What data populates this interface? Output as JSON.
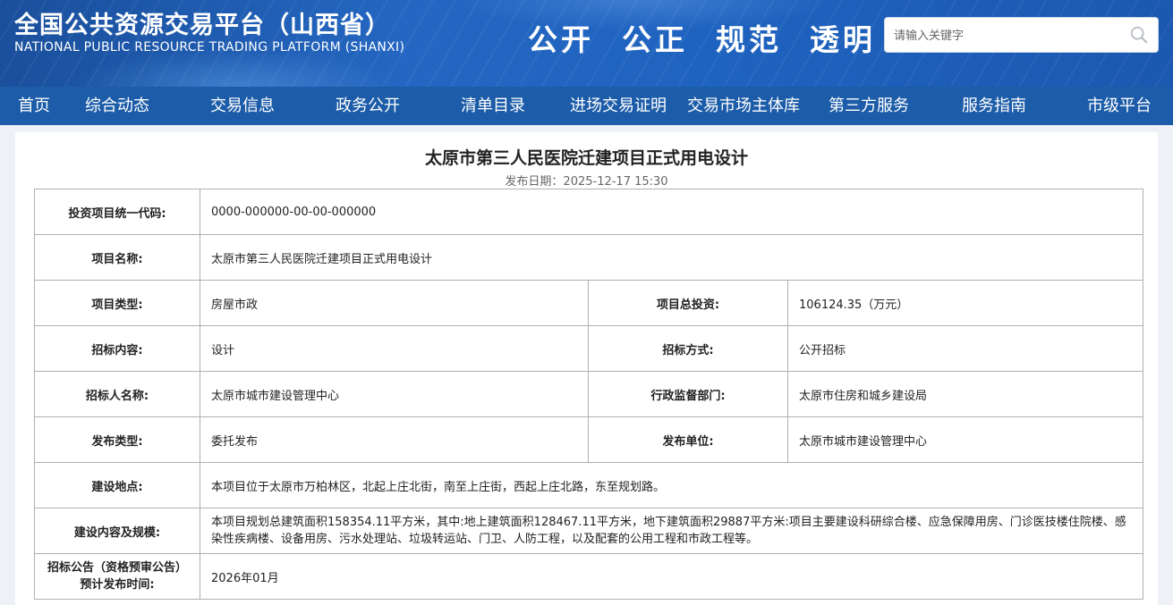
{
  "header": {
    "title_cn": "全国公共资源交易平台（山西省）",
    "title_en": "NATIONAL PUBLIC RESOURCE TRADING PLATFORM (SHANXI)",
    "slogan": "公开  公正  规范  透明",
    "search": {
      "placeholder": "请输入关键字",
      "icon": "search-icon"
    }
  },
  "nav": {
    "items": [
      "首页",
      "综合动态",
      "交易信息",
      "政务公开",
      "清单目录",
      "进场交易证明",
      "交易市场主体库",
      "第三方服务",
      "服务指南",
      "市级平台"
    ]
  },
  "page": {
    "title": "太原市第三人民医院迁建项目正式用电设计",
    "publish_date": "发布日期：2025-12-17 15:30"
  },
  "table": {
    "project_code_label": "投资项目统一代码:",
    "project_code": "0000-000000-00-00-000000",
    "project_name_label": "项目名称:",
    "project_name": "太原市第三人民医院迁建项目正式用电设计",
    "project_type_label": "项目类型:",
    "project_type": "房屋市政",
    "total_investment_label": "项目总投资:",
    "total_investment": "106124.35（万元）",
    "bid_content_label": "招标内容:",
    "bid_content": "设计",
    "bid_method_label": "招标方式:",
    "bid_method": "公开招标",
    "tenderer_label": "招标人名称:",
    "tenderer": "太原市城市建设管理中心",
    "supervisor_label": "行政监督部门:",
    "supervisor": "太原市住房和城乡建设局",
    "publish_type_label": "发布类型:",
    "publish_type": "委托发布",
    "publisher_label": "发布单位:",
    "publisher": "太原市城市建设管理中心",
    "location_label": "建设地点:",
    "location": "本项目位于太原市万柏林区，北起上庄北街，南至上庄街，西起上庄北路，东至规划路。",
    "scope_label": "建设内容及规模:",
    "scope": "本项目规划总建筑面积158354.11平方米，其中:地上建筑面积128467.11平方米，地下建筑面积29887平方米:项目主要建设科研综合楼、应急保障用房、门诊医技楼住院楼、感染性疾病楼、设备用房、污水处理站、垃圾转运站、门卫、人防工程，以及配套的公用工程和市政工程等。",
    "notice_time_label_1": "招标公告（资格预审公告）",
    "notice_time_label_2": "预计发布时间:",
    "notice_time": "2026年01月"
  }
}
